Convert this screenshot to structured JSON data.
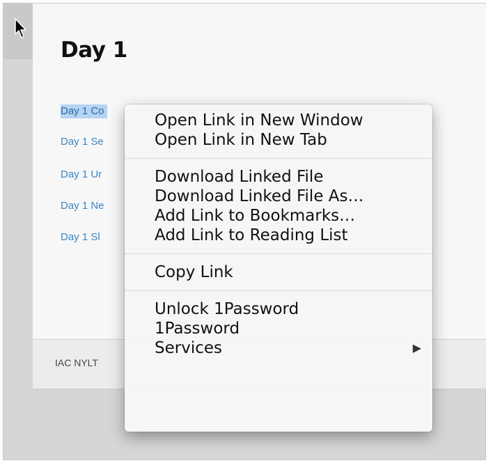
{
  "page": {
    "title": "Day 1",
    "links": [
      {
        "label": "Day 1 Co",
        "selected": true
      },
      {
        "label": "Day 1 Se",
        "selected": false
      },
      {
        "label": "Day 1 Ur",
        "selected": false
      },
      {
        "label": "Day 1 Ne",
        "selected": false
      },
      {
        "label": "Day 1 Sl",
        "selected": false
      }
    ],
    "footer_text": "IAC NYLT"
  },
  "context_menu": {
    "groups": [
      [
        {
          "label": "Open Link in New Window"
        },
        {
          "label": "Open Link in New Tab"
        }
      ],
      [
        {
          "label": "Download Linked File"
        },
        {
          "label": "Download Linked File As…"
        },
        {
          "label": "Add Link to Bookmarks…"
        },
        {
          "label": "Add Link to Reading List"
        }
      ],
      [
        {
          "label": "Copy Link"
        }
      ],
      [
        {
          "label": "Unlock 1Password"
        },
        {
          "label": "1Password"
        },
        {
          "label": "Services",
          "submenu_arrow": "▶"
        }
      ]
    ]
  },
  "colors": {
    "link": "#3a86c6",
    "selection": "#b5d3f3",
    "menu_background": "#f6f6f6"
  },
  "icons": {
    "cursor": "arrow-cursor-icon",
    "submenu": "chevron-right-icon"
  }
}
